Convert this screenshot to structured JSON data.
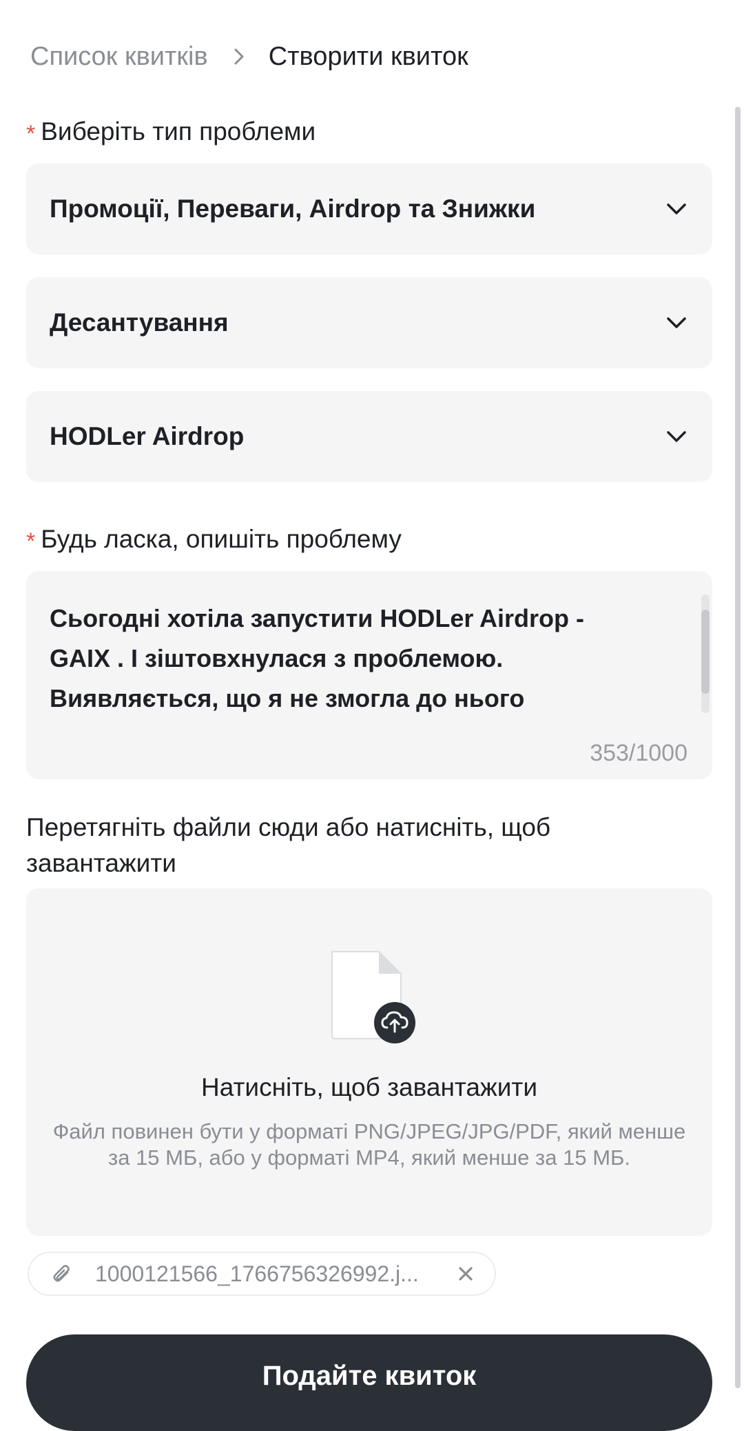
{
  "breadcrumb": {
    "parent": "Список квитків",
    "current": "Створити квиток"
  },
  "problem_type": {
    "label": "Виберіть тип проблеми",
    "required_mark": "*",
    "category": "Промоції, Переваги, Airdrop та Знижки",
    "subcategory": "Десантування",
    "topic": "HODLer Airdrop"
  },
  "description": {
    "label": "Будь ласка, опишіть проблему",
    "required_mark": "*",
    "value": "Сьогодні хотіла запустити HODLer Airdrop -\nGAIX . І зіштовхнулася з проблемою.\nВиявляється, що я не змогла до нього",
    "counter": "353/1000"
  },
  "upload": {
    "label": "Перетягніть файли сюди або натисніть, щоб завантажити",
    "title": "Натисніть, щоб завантажити",
    "hint": "Файл повинен бути у форматі PNG/JPEG/JPG/PDF, який менше за 15 МБ, або у форматі MP4, який менше за 15 МБ.",
    "attached_file": "1000121566_1766756326992.j..."
  },
  "submit_label": "Подайте квиток",
  "icons": {
    "breadcrumb_separator": "chevron-right-icon",
    "select_toggle": "chevron-down-icon",
    "file": "file-icon",
    "upload": "cloud-upload-icon",
    "attachment": "paperclip-icon",
    "remove": "close-icon"
  },
  "colors": {
    "required": "#e0533e",
    "field_bg": "#f5f5f6",
    "button_bg": "#2b2f36",
    "muted_text": "#8a8d93"
  }
}
